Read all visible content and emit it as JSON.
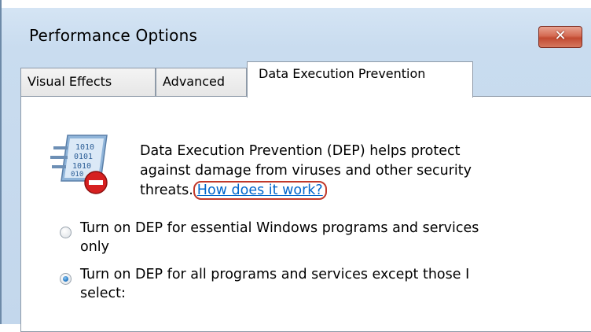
{
  "window": {
    "title": "Performance Options",
    "close_glyph": "✕"
  },
  "tabs": [
    {
      "label": "Visual Effects",
      "active": false
    },
    {
      "label": "Advanced",
      "active": false
    },
    {
      "label": "Data Execution Prevention",
      "active": true
    }
  ],
  "dep": {
    "icon": "dep-shield-binary-icon",
    "description_lines": [
      "Data Execution Prevention (DEP) helps protect",
      "against damage from viruses and other security",
      "threats."
    ],
    "help_link": "How does it work?"
  },
  "options": [
    {
      "lines": [
        "Turn on DEP for essential Windows programs and services",
        "only"
      ],
      "selected": false
    },
    {
      "lines": [
        "Turn on DEP for all programs and services except those I",
        "select:"
      ],
      "selected": true
    }
  ],
  "colors": {
    "link": "#0066cc",
    "link_highlight": "#c0392b",
    "radio_selected": "#2a7dc6",
    "close_button": "#c24a31"
  }
}
